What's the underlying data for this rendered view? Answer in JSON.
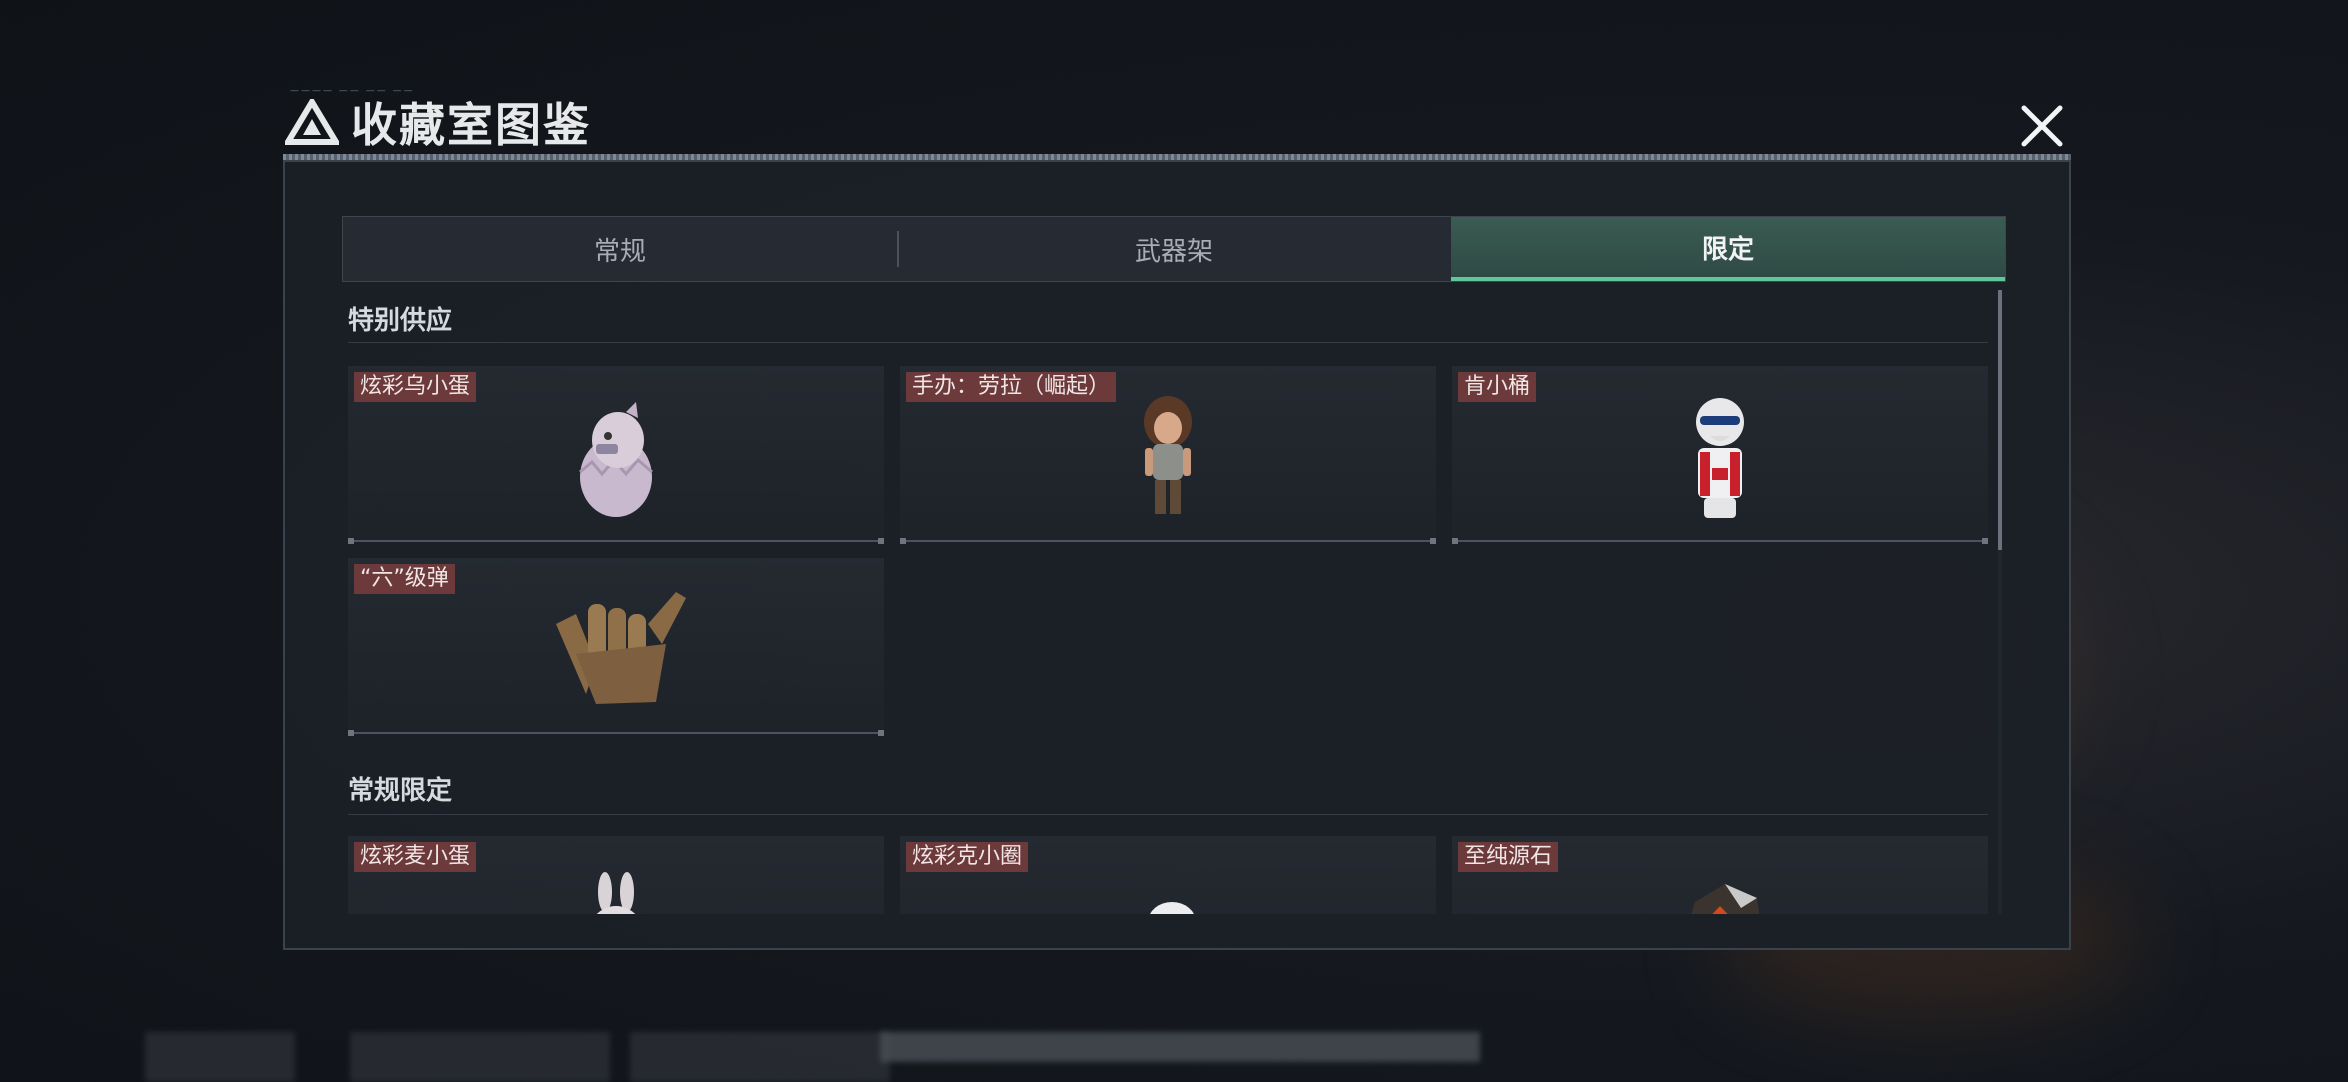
{
  "window": {
    "title": "收藏室图鉴",
    "close_label": "close"
  },
  "tabs": [
    {
      "label": "常规",
      "active": false
    },
    {
      "label": "武器架",
      "active": false
    },
    {
      "label": "限定",
      "active": true
    }
  ],
  "sections": [
    {
      "title": "特别供应",
      "items": [
        {
          "label": "炫彩乌小蛋",
          "icon": "hatching-egg-creature-icon"
        },
        {
          "label": "手办：劳拉（崛起）",
          "icon": "lara-figure-icon"
        },
        {
          "label": "肯小桶",
          "icon": "kfc-bucket-figure-icon"
        },
        {
          "label": "“六”级弹",
          "icon": "hand-gesture-icon"
        }
      ]
    },
    {
      "title": "常规限定",
      "items": [
        {
          "label": "炫彩麦小蛋",
          "icon": "rabbit-egg-icon"
        },
        {
          "label": "炫彩克小圈",
          "icon": "hat-figure-icon"
        },
        {
          "label": "至纯源石",
          "icon": "source-stone-icon"
        }
      ]
    }
  ],
  "colors": {
    "accent": "#5fc79a",
    "label_bg": "#6d3a3c",
    "panel": "#1b2027"
  }
}
